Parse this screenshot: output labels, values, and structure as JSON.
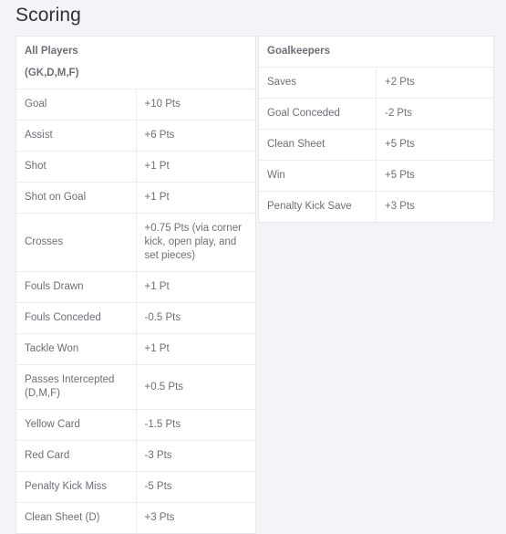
{
  "page": {
    "title": "Scoring",
    "background_color": "#f4f4f8",
    "surface_color": "#ffffff",
    "border_color": "#e6e6ec",
    "text_color": "#6e6e78",
    "heading_color": "#2f2f37"
  },
  "tables": [
    {
      "id": "all-players",
      "header_line1": "All Players",
      "header_line2": "(GK,D,M,F)",
      "rows": [
        {
          "name": "Goal",
          "value": "+10 Pts"
        },
        {
          "name": "Assist",
          "value": "+6 Pts"
        },
        {
          "name": "Shot",
          "value": "+1 Pt"
        },
        {
          "name": "Shot on Goal",
          "value": "+1 Pt"
        },
        {
          "name": "Crosses",
          "value": "+0.75 Pts (via corner kick, open play, and set pieces)"
        },
        {
          "name": "Fouls Drawn",
          "value": "+1 Pt"
        },
        {
          "name": "Fouls Conceded",
          "value": "-0.5 Pts"
        },
        {
          "name": "Tackle Won",
          "value": "+1 Pt"
        },
        {
          "name": "Passes Intercepted (D,M,F)",
          "value": "+0.5 Pts"
        },
        {
          "name": "Yellow Card",
          "value": "-1.5 Pts"
        },
        {
          "name": "Red Card",
          "value": "-3 Pts"
        },
        {
          "name": "Penalty Kick Miss",
          "value": "-5 Pts"
        },
        {
          "name": "Clean Sheet (D)",
          "value": "+3 Pts"
        }
      ]
    },
    {
      "id": "goalkeepers",
      "header_line1": "Goalkeepers",
      "header_line2": "",
      "rows": [
        {
          "name": "Saves",
          "value": "+2 Pts"
        },
        {
          "name": "Goal Conceded",
          "value": "-2 Pts"
        },
        {
          "name": "Clean Sheet",
          "value": "+5 Pts"
        },
        {
          "name": "Win",
          "value": "+5 Pts"
        },
        {
          "name": "Penalty Kick Save",
          "value": "+3 Pts"
        }
      ]
    }
  ]
}
